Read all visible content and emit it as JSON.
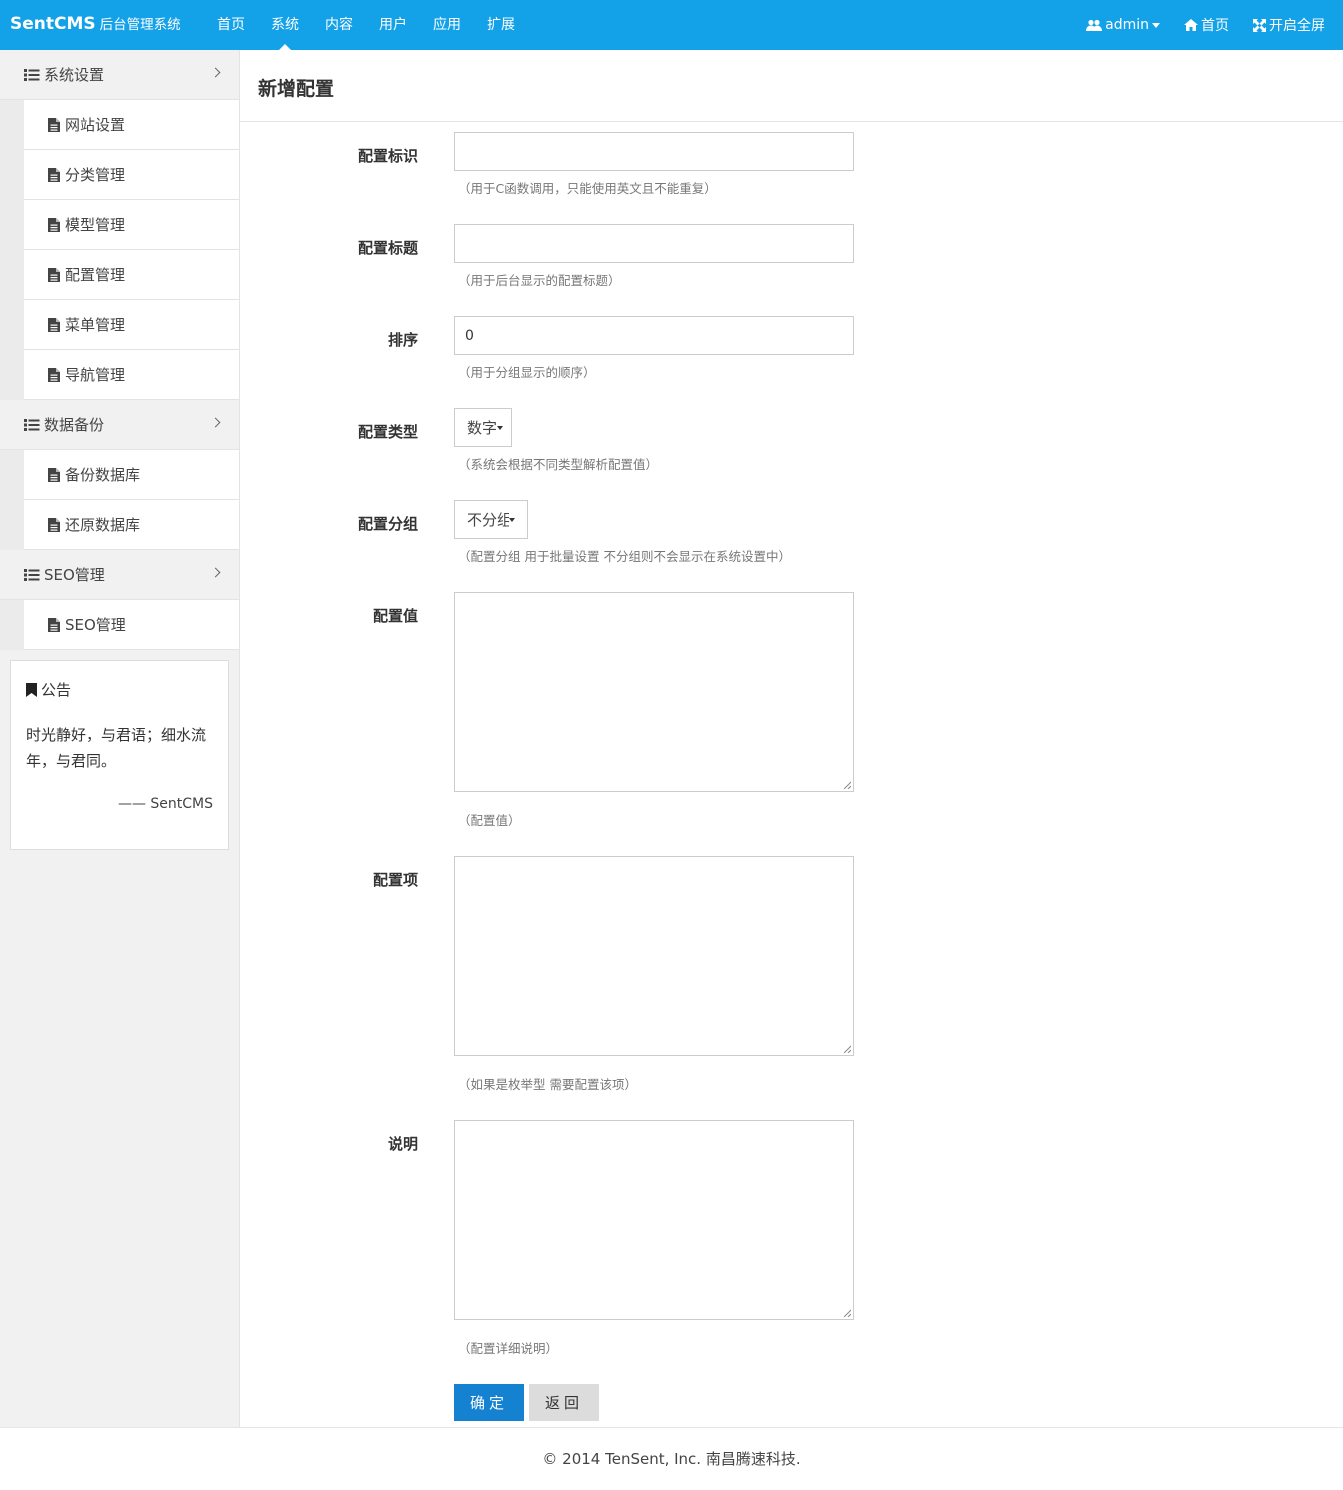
{
  "brand": {
    "name": "SentCMS",
    "subtitle": "后台管理系统"
  },
  "topnav": [
    "首页",
    "系统",
    "内容",
    "用户",
    "应用",
    "扩展"
  ],
  "topnav_active": 1,
  "topright": {
    "user": "admin",
    "home": "首页",
    "fullscreen": "开启全屏"
  },
  "sidebar": {
    "groups": [
      {
        "label": "系统设置",
        "items": [
          "网站设置",
          "分类管理",
          "模型管理",
          "配置管理",
          "菜单管理",
          "导航管理"
        ]
      },
      {
        "label": "数据备份",
        "items": [
          "备份数据库",
          "还原数据库"
        ]
      },
      {
        "label": "SEO管理",
        "items": [
          "SEO管理"
        ]
      }
    ]
  },
  "notice": {
    "title": "公告",
    "body": "时光静好，与君语；细水流年，与君同。",
    "signature": "—— SentCMS"
  },
  "page_title": "新增配置",
  "form": {
    "name": {
      "label": "配置标识",
      "value": "",
      "help": "（用于C函数调用，只能使用英文且不能重复）"
    },
    "title": {
      "label": "配置标题",
      "value": "",
      "help": "（用于后台显示的配置标题）"
    },
    "sort": {
      "label": "排序",
      "value": "0",
      "help": "（用于分组显示的顺序）"
    },
    "type": {
      "label": "配置类型",
      "value": "数字",
      "help": "（系统会根据不同类型解析配置值）"
    },
    "group": {
      "label": "配置分组",
      "value": "不分组",
      "help": "（配置分组 用于批量设置 不分组则不会显示在系统设置中）"
    },
    "value": {
      "label": "配置值",
      "help": "（配置值）"
    },
    "extra": {
      "label": "配置项",
      "help": "（如果是枚举型 需要配置该项）"
    },
    "remark": {
      "label": "说明",
      "help": "（配置详细说明）"
    }
  },
  "buttons": {
    "submit": "确定",
    "back": "返回"
  },
  "footer": "© 2014 TenSent, Inc. 南昌腾速科技."
}
